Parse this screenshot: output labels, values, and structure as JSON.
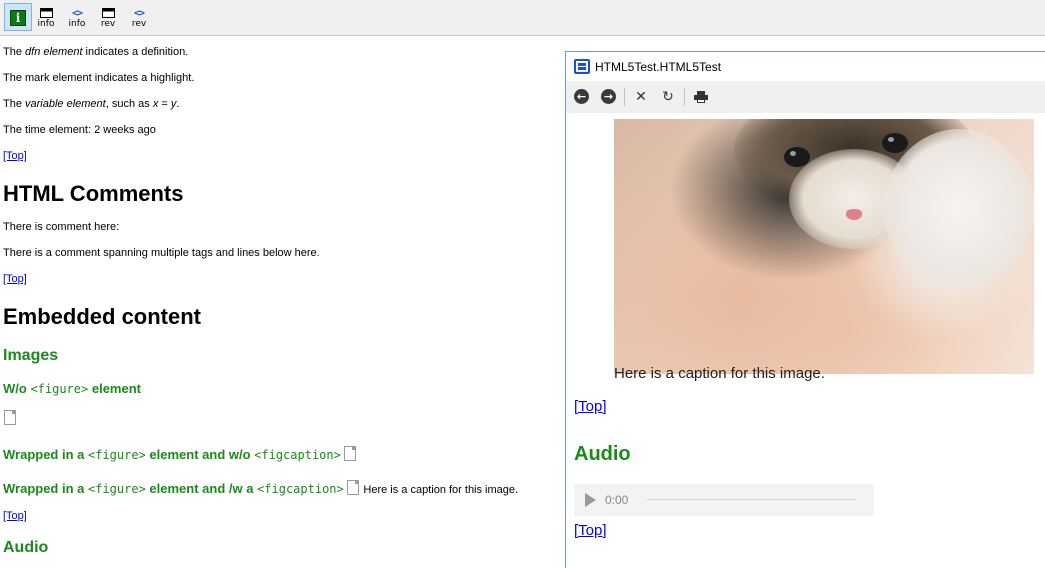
{
  "toolbar": {
    "buttons": [
      {
        "caption": "",
        "icon": "info-green-icon"
      },
      {
        "caption": "info",
        "icon": "window-icon"
      },
      {
        "caption": "info",
        "icon": "code-icon"
      },
      {
        "caption": "rev",
        "icon": "window-icon"
      },
      {
        "caption": "rev",
        "icon": "code-icon"
      }
    ],
    "code_glyph": "<>"
  },
  "page": {
    "dfn_before": "The ",
    "dfn_em": "dfn element",
    "dfn_after": " indicates a definition.",
    "mark_line": "The mark element indicates a highlight.",
    "var_before": "The ",
    "var_em": "variable element",
    "var_mid": ", such as ",
    "var_x": "x",
    "var_eq": " = ",
    "var_y": "y",
    "var_end": ".",
    "time_line": "The time element: 2 weeks ago",
    "top_link": "[Top]",
    "comments_heading": "HTML Comments",
    "comment_line1": "There is comment here:",
    "comment_line2": "There is a comment spanning multiple tags and lines below here.",
    "embedded_heading": "Embedded content",
    "images_heading": "Images",
    "wo_figure_prefix": "W/o ",
    "figure_tag": "<figure>",
    "element_word": " element",
    "wrapped_prefix": "Wrapped in a ",
    "wrapped_mid_wo": " element and w/o ",
    "wrapped_mid_w": " element and /w a ",
    "figcaption_tag": "<figcaption>",
    "inline_caption": "Here is a caption for this image.",
    "audio_heading": "Audio"
  },
  "preview": {
    "title": "HTML5Test.HTML5Test",
    "nav": {
      "back": "back-icon",
      "forward": "forward-icon",
      "stop": "close-icon",
      "refresh": "refresh-icon",
      "print": "print-icon"
    },
    "image_caption": "Here is a caption for this image.",
    "top_link": "[Top]",
    "audio_heading": "Audio",
    "audio_time": "0:00"
  },
  "colors": {
    "heading_green": "#1a8a1a",
    "link_blue": "#0000ee",
    "window_border": "#6a9bd8"
  }
}
